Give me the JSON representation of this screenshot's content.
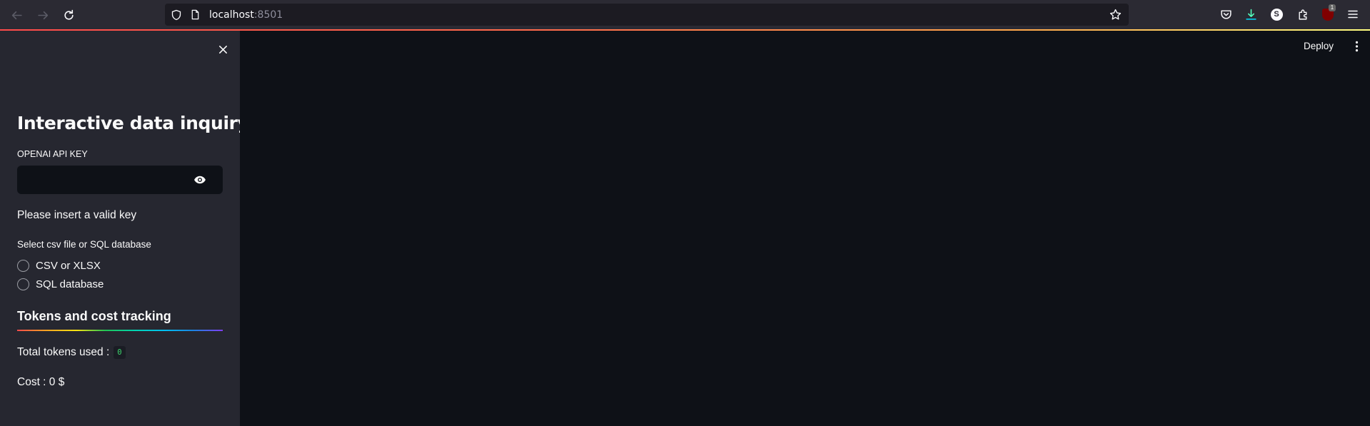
{
  "browser": {
    "url_host": "localhost",
    "url_port": ":8501",
    "extension_badge": "1",
    "profile_initial": "S"
  },
  "sidebar": {
    "title": "Interactive data inquiry",
    "api_key_label": "OPENAI API KEY",
    "api_key_value": "",
    "warning_text": "Please insert a valid key",
    "source_label": "Select csv file or SQL database",
    "source_options": [
      {
        "label": "CSV or XLSX",
        "selected": false
      },
      {
        "label": "SQL database",
        "selected": false
      }
    ],
    "tracking_title": "Tokens and cost tracking",
    "tokens_label": "Total tokens used :",
    "tokens_value": "0",
    "cost_text": "Cost : 0 $"
  },
  "main": {
    "deploy_label": "Deploy"
  },
  "colors": {
    "sidebar_bg": "#262730",
    "main_bg": "#0e1117",
    "accent": "#ff4b4b",
    "code_green": "#3dd56d"
  }
}
